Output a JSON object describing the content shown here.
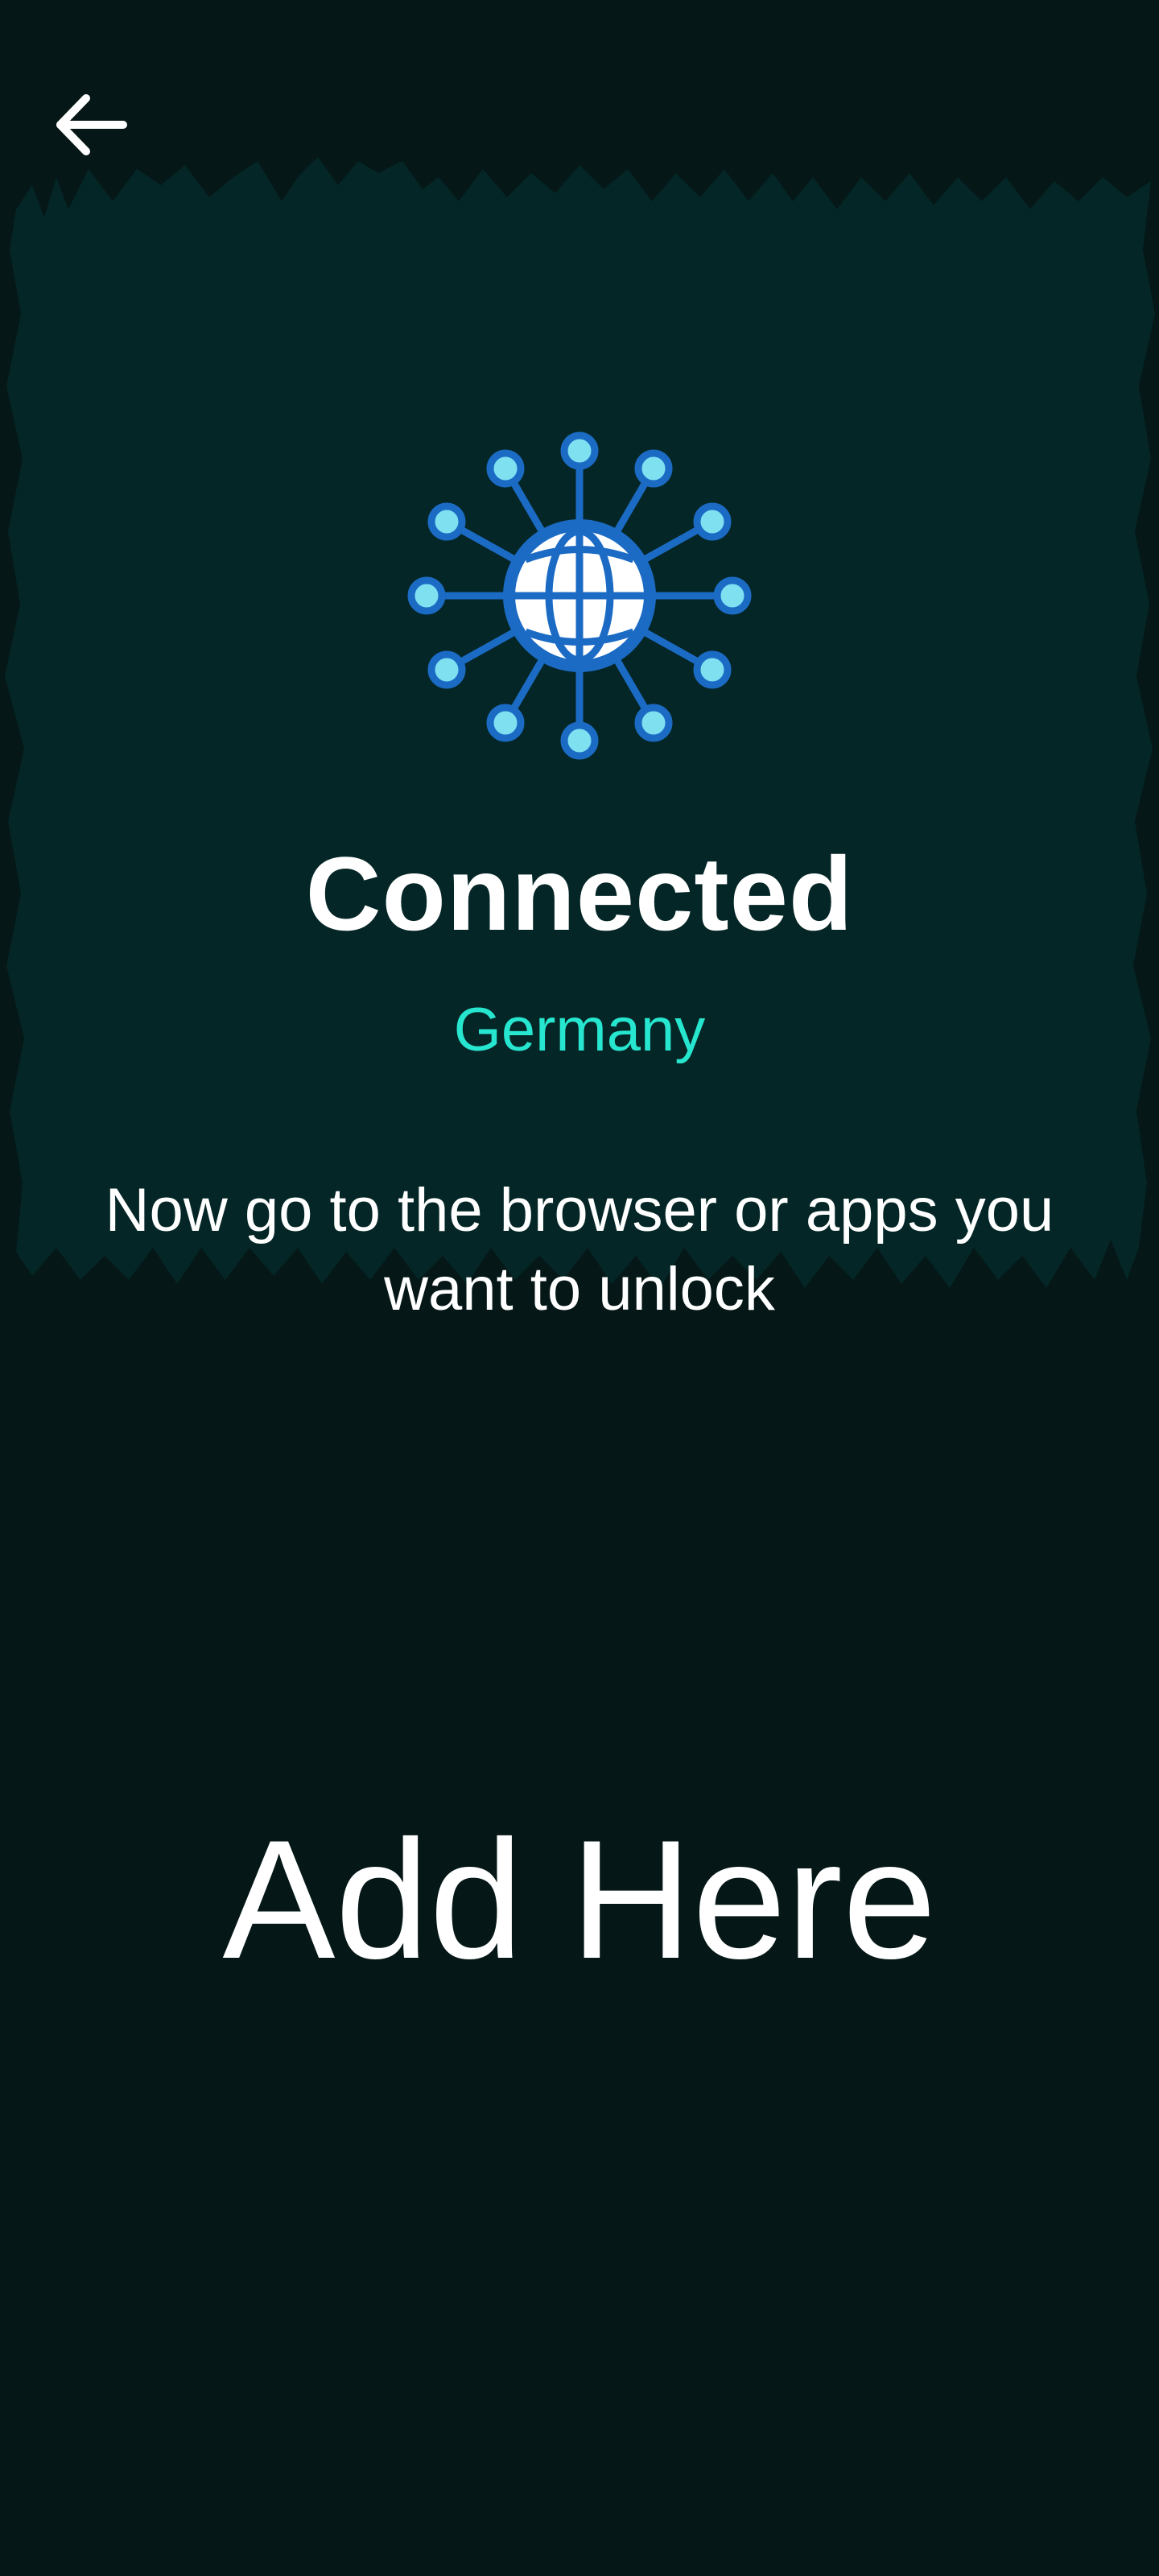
{
  "header": {
    "back_icon": "arrow-left-icon"
  },
  "connection": {
    "status": "Connected",
    "country": "Germany",
    "instructions": "Now go to the browser or apps you want to unlock",
    "icon": "network-globe-icon"
  },
  "ad": {
    "placeholder_text": "Add Here"
  },
  "colors": {
    "background": "#051717",
    "hero_panel": "#052626",
    "accent_country": "#27e6cf",
    "globe_blue": "#1b6bc4",
    "node_fill": "#7fe0f0"
  }
}
